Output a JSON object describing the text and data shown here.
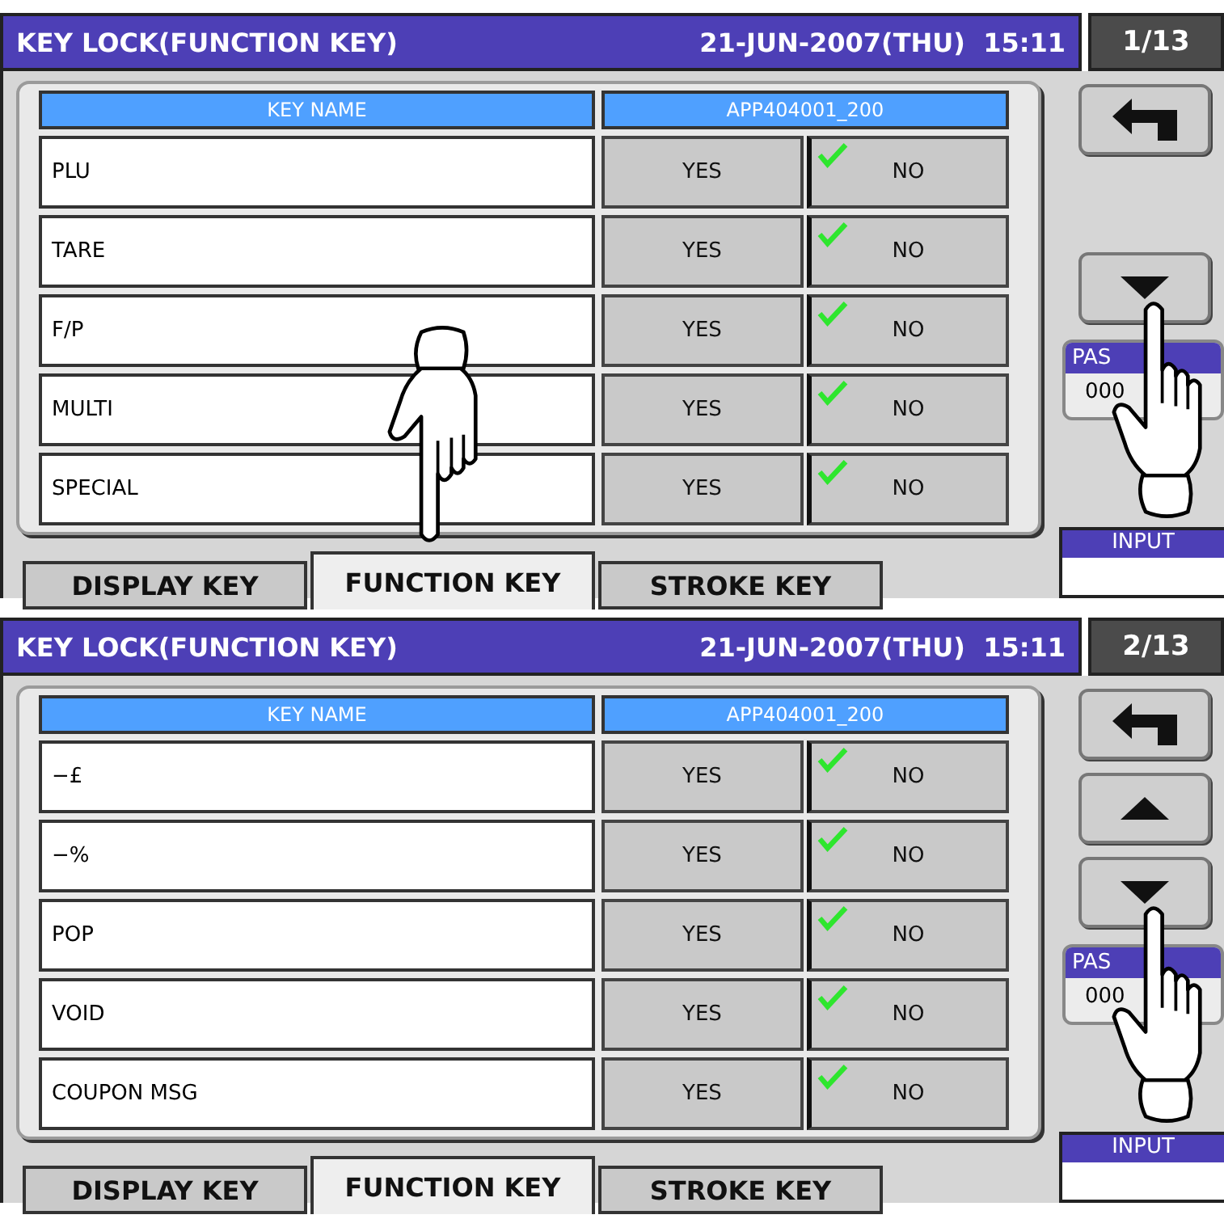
{
  "screens": [
    {
      "title": "KEY LOCK(FUNCTION KEY)",
      "date_time": "21-JUN-2007(THU)  15:11",
      "page": "1/13",
      "columns": [
        "KEY NAME",
        "APP404001_200"
      ],
      "rows": [
        {
          "name": "PLU",
          "options": [
            {
              "label": "YES",
              "selected": false
            },
            {
              "label": "NO",
              "selected": true
            }
          ]
        },
        {
          "name": "TARE",
          "options": [
            {
              "label": "YES",
              "selected": false
            },
            {
              "label": "NO",
              "selected": true
            }
          ]
        },
        {
          "name": "F/P",
          "options": [
            {
              "label": "YES",
              "selected": false
            },
            {
              "label": "NO",
              "selected": true
            }
          ]
        },
        {
          "name": "MULTI",
          "options": [
            {
              "label": "YES",
              "selected": false
            },
            {
              "label": "NO",
              "selected": true
            }
          ]
        },
        {
          "name": "SPECIAL",
          "options": [
            {
              "label": "YES",
              "selected": false
            },
            {
              "label": "NO",
              "selected": true
            }
          ]
        }
      ],
      "nav": {
        "back": true,
        "up": false,
        "down": true
      },
      "passcode": {
        "label": "PAS",
        "value": "000"
      },
      "input": {
        "label": "INPUT"
      },
      "tabs": [
        {
          "label": "DISPLAY KEY",
          "selected": false
        },
        {
          "label": "FUNCTION KEY",
          "selected": true
        },
        {
          "label": "STROKE KEY",
          "selected": false
        }
      ],
      "hands": [
        {
          "kind": "tab"
        },
        {
          "kind": "down_button"
        }
      ]
    },
    {
      "title": "KEY LOCK(FUNCTION KEY)",
      "date_time": "21-JUN-2007(THU)  15:11",
      "page": "2/13",
      "columns": [
        "KEY NAME",
        "APP404001_200"
      ],
      "rows": [
        {
          "name": "−£",
          "options": [
            {
              "label": "YES",
              "selected": false
            },
            {
              "label": "NO",
              "selected": true
            }
          ]
        },
        {
          "name": "−%",
          "options": [
            {
              "label": "YES",
              "selected": false
            },
            {
              "label": "NO",
              "selected": true
            }
          ]
        },
        {
          "name": "POP",
          "options": [
            {
              "label": "YES",
              "selected": false
            },
            {
              "label": "NO",
              "selected": true
            }
          ]
        },
        {
          "name": "VOID",
          "options": [
            {
              "label": "YES",
              "selected": false
            },
            {
              "label": "NO",
              "selected": true
            }
          ]
        },
        {
          "name": "COUPON MSG",
          "options": [
            {
              "label": "YES",
              "selected": false
            },
            {
              "label": "NO",
              "selected": true
            }
          ]
        }
      ],
      "nav": {
        "back": true,
        "up": true,
        "down": true
      },
      "passcode": {
        "label": "PAS",
        "value": "000"
      },
      "input": {
        "label": "INPUT"
      },
      "tabs": [
        {
          "label": "DISPLAY KEY",
          "selected": false
        },
        {
          "label": "FUNCTION KEY",
          "selected": true
        },
        {
          "label": "STROKE KEY",
          "selected": false
        }
      ],
      "hands": [
        {
          "kind": "down_button"
        }
      ]
    }
  ]
}
